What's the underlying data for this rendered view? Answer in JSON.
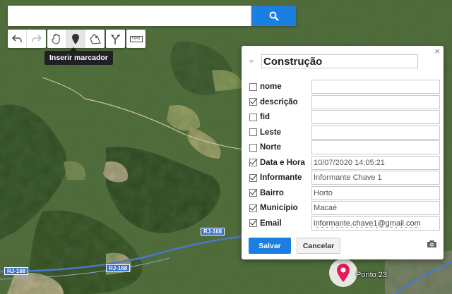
{
  "search": {
    "placeholder": "",
    "value": ""
  },
  "toolbar": {
    "tooltip": "Inserir marcador",
    "groups": [
      {
        "buttons": [
          "undo-icon",
          "redo-icon"
        ]
      },
      {
        "buttons": [
          "hand-pan-icon",
          "marker-pin-icon",
          "polygon-draw-icon"
        ],
        "active": "marker-pin-icon"
      },
      {
        "buttons": [
          "route-split-icon"
        ]
      },
      {
        "buttons": [
          "ruler-icon"
        ]
      }
    ]
  },
  "map": {
    "road_labels": [
      "RJ-168",
      "RJ-168",
      "RJ-168"
    ],
    "place_label": "Ponto 23",
    "marker_color": "#e8175d"
  },
  "dialog": {
    "close": "×",
    "title": "Construção",
    "fields": [
      {
        "label": "nome",
        "checked": false,
        "value": ""
      },
      {
        "label": "descrição",
        "checked": true,
        "value": ""
      },
      {
        "label": "fid",
        "checked": false,
        "value": ""
      },
      {
        "label": "Leste",
        "checked": false,
        "value": ""
      },
      {
        "label": "Norte",
        "checked": false,
        "value": ""
      },
      {
        "label": "Data e Hora",
        "checked": true,
        "value": "10/07/2020 14:05:21"
      },
      {
        "label": "Informante",
        "checked": true,
        "value": "Informante Chave 1"
      },
      {
        "label": "Bairro",
        "checked": true,
        "value": "Horto"
      },
      {
        "label": "Município",
        "checked": true,
        "value": "Macaé"
      },
      {
        "label": "Email",
        "checked": true,
        "value": "informante.chave1@gmail.com"
      }
    ],
    "save_label": "Salvar",
    "cancel_label": "Cancelar"
  },
  "colors": {
    "accent": "#1a7fe0",
    "tooltip_bg": "#202124",
    "marker": "#e8175d"
  }
}
